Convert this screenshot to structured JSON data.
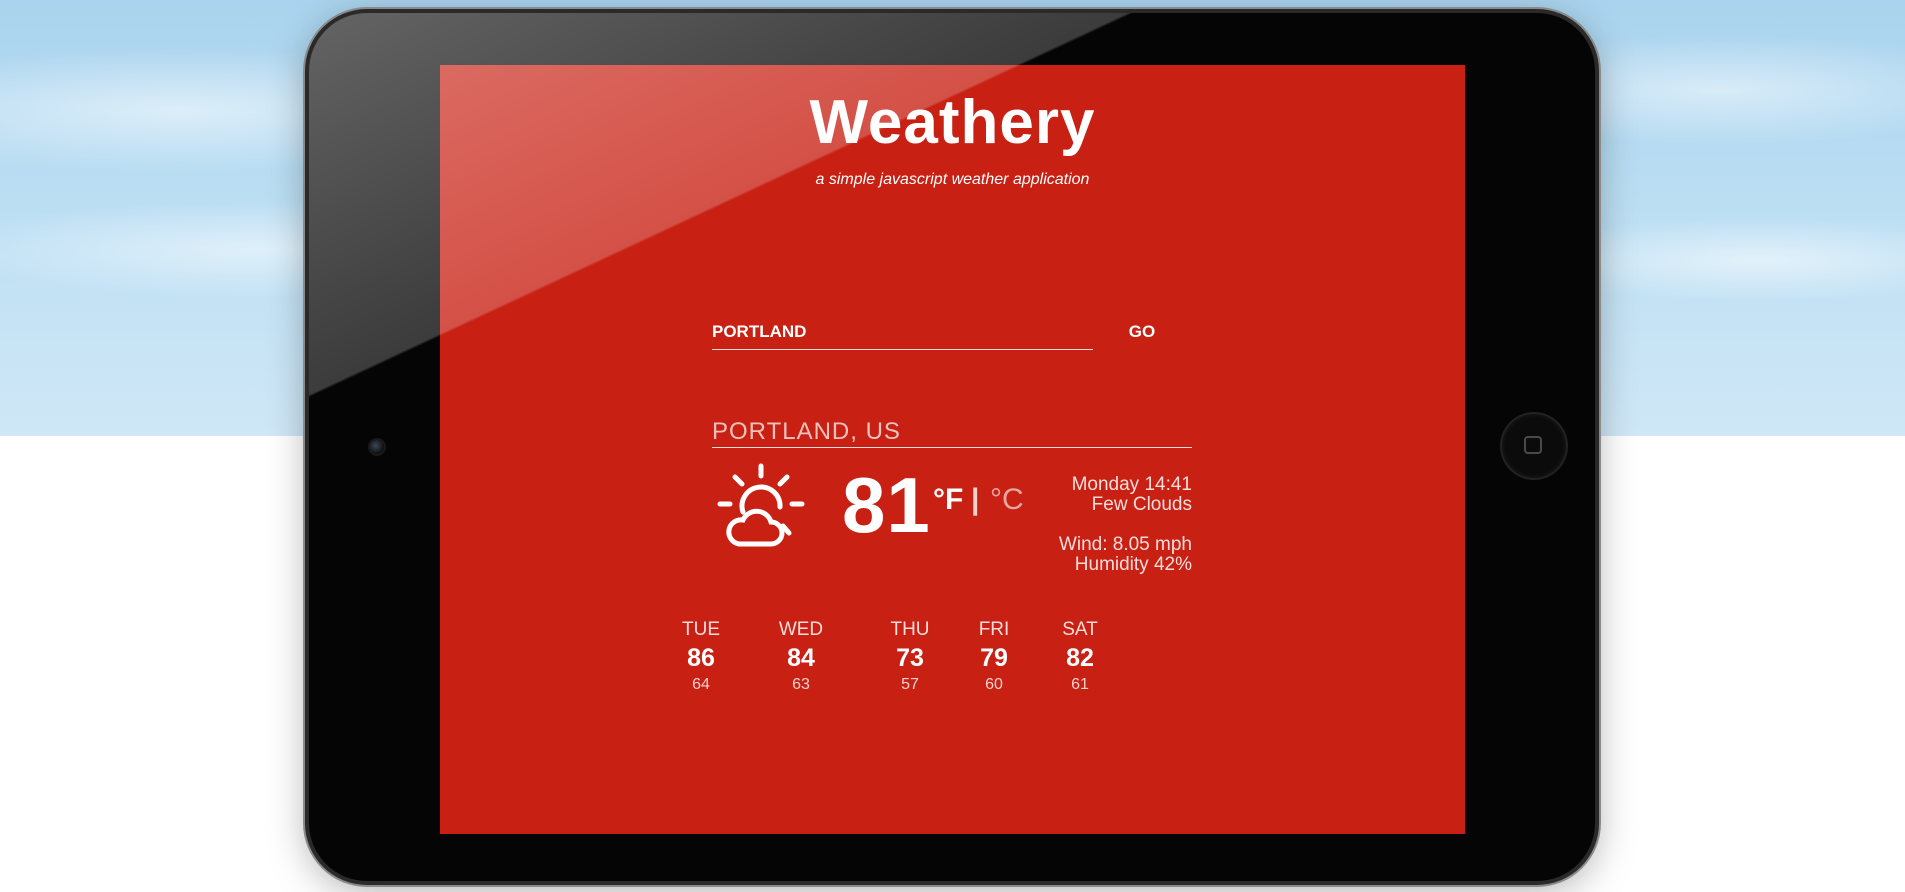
{
  "app": {
    "title": "Weathery",
    "subtitle": "a simple javascript weather application"
  },
  "search": {
    "value": "PORTLAND",
    "go_label": "GO"
  },
  "current": {
    "location": "PORTLAND, US",
    "icon": "sun-cloud-icon",
    "temperature": "81",
    "unit_f": "°F",
    "unit_separator": "|",
    "unit_c": "°C",
    "datetime": "Monday 14:41",
    "condition": "Few Clouds",
    "wind": "Wind: 8.05 mph",
    "humidity": "Humidity 42%"
  },
  "forecast": [
    {
      "day": "TUE",
      "high": "86",
      "low": "64"
    },
    {
      "day": "WED",
      "high": "84",
      "low": "63"
    },
    {
      "day": "THU",
      "high": "73",
      "low": "57"
    },
    {
      "day": "FRI",
      "high": "79",
      "low": "60"
    },
    {
      "day": "SAT",
      "high": "82",
      "low": "61"
    }
  ],
  "colors": {
    "screen_background": "#c82013",
    "text": "#ffffff",
    "device_body": "#050505",
    "sky": "#a9d3ee"
  }
}
